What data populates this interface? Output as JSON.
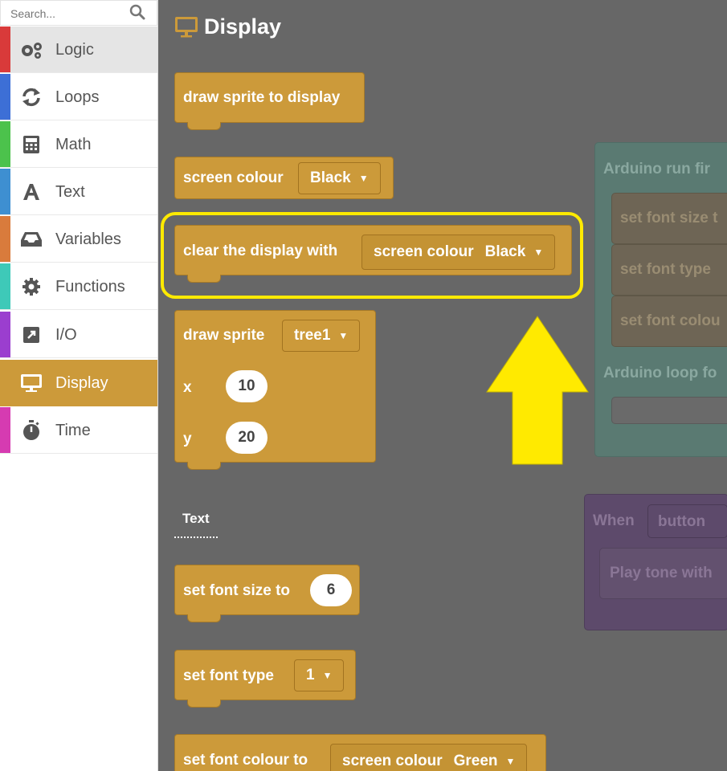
{
  "search": {
    "placeholder": "Search..."
  },
  "categories": [
    {
      "label": "Logic",
      "color": "#d93a3a",
      "icon": "gears-icon"
    },
    {
      "label": "Loops",
      "color": "#3d6fd6",
      "icon": "refresh-icon"
    },
    {
      "label": "Math",
      "color": "#4cc24c",
      "icon": "calculator-icon"
    },
    {
      "label": "Text",
      "color": "#3e8fd1",
      "icon": "font-icon"
    },
    {
      "label": "Variables",
      "color": "#d97b3c",
      "icon": "inbox-icon"
    },
    {
      "label": "Functions",
      "color": "#3ec9b8",
      "icon": "gear-icon"
    },
    {
      "label": "I/O",
      "color": "#9b3ecf",
      "icon": "external-link-icon"
    },
    {
      "label": "Display",
      "color": "#cc9a3a",
      "icon": "monitor-icon"
    },
    {
      "label": "Time",
      "color": "#d63bb1",
      "icon": "stopwatch-icon"
    }
  ],
  "workspace": {
    "heading": "Display",
    "blocks": {
      "draw_sprite_display": "draw sprite to display",
      "screen_colour": {
        "label": "screen colour",
        "value": "Black"
      },
      "clear_display": {
        "label": "clear the display with",
        "inner_label": "screen colour",
        "value": "Black"
      },
      "draw_sprite": {
        "label": "draw sprite",
        "sprite": "tree1",
        "x_label": "x",
        "x_value": "10",
        "y_label": "y",
        "y_value": "20"
      },
      "set_font_size": {
        "label": "set font size to",
        "value": "6"
      },
      "set_font_type": {
        "label": "set font type",
        "value": "1"
      },
      "set_font_colour": {
        "label": "set font colour to",
        "inner_label": "screen colour",
        "value": "Green"
      }
    },
    "text_section": "Text",
    "background": {
      "arduino_run": "Arduino run fir",
      "set_font_size": "set font size t",
      "set_font_type": "set font type",
      "set_font_colour": "set font colou",
      "arduino_loop": "Arduino loop fo",
      "when": "When",
      "button": "button",
      "play_tone": "Play tone with"
    }
  },
  "colors": {
    "accent": "#cc9a3a",
    "highlight": "#ffea00",
    "workspace": "#676767"
  }
}
